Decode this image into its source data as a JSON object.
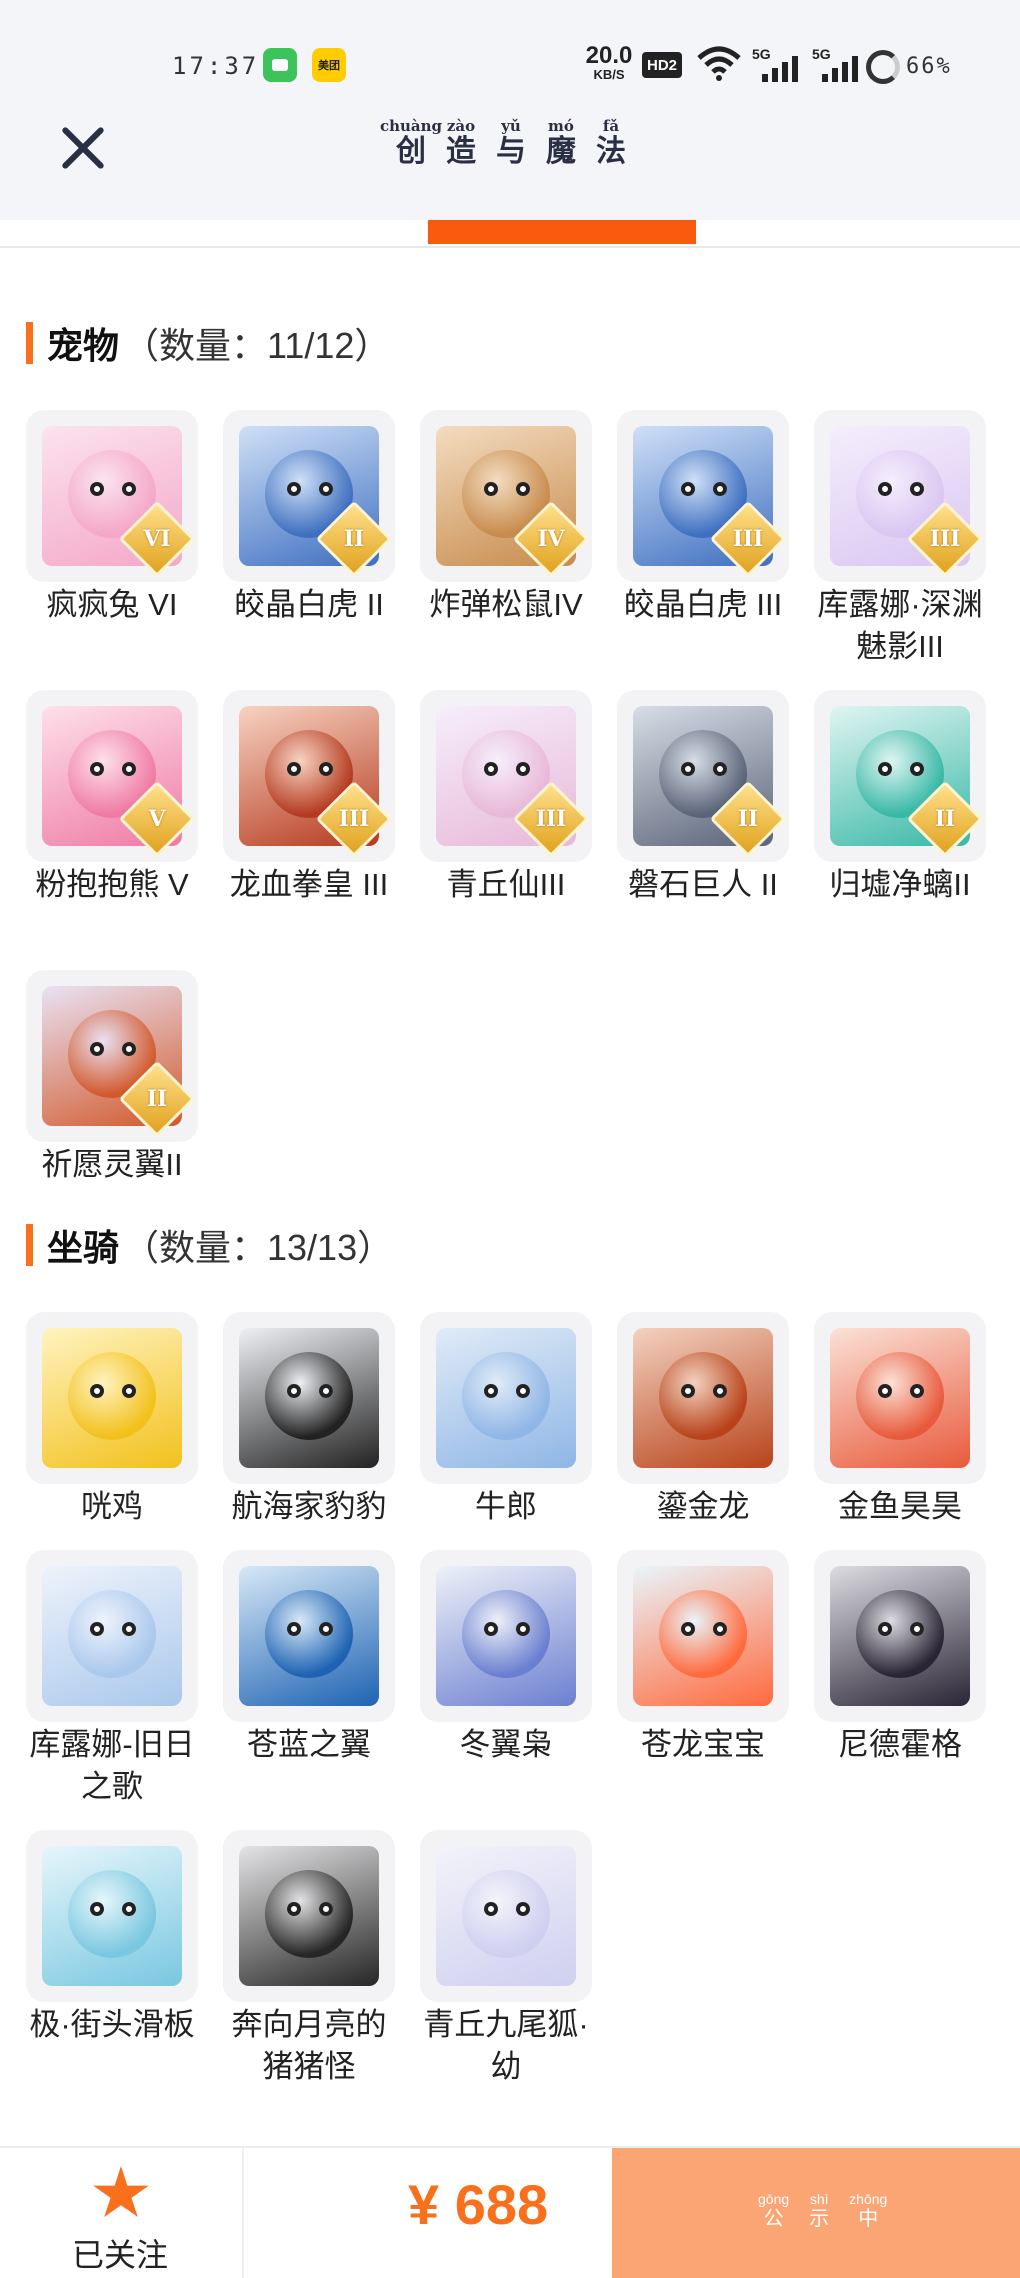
{
  "status_bar": {
    "time": "17:37",
    "app_icons": [
      "message-icon",
      "meituan-icon"
    ],
    "meituan_label": "美团",
    "speed_value": "20.0",
    "speed_unit": "KB/S",
    "hd_label": "HD2",
    "signal1": "5G",
    "signal2": "5G",
    "battery": "66%"
  },
  "header": {
    "title_chars": [
      {
        "py": "chuàng",
        "hz": "创"
      },
      {
        "py": "zào",
        "hz": "造"
      },
      {
        "py": "yǔ",
        "hz": "与"
      },
      {
        "py": "mó",
        "hz": "魔"
      },
      {
        "py": "fǎ",
        "hz": "法"
      }
    ],
    "accent_color": "#f85b0e"
  },
  "pets": {
    "title": "宠物",
    "count": "（数量：11/12）",
    "items": [
      {
        "label": "疯疯兔 VI",
        "badge": "VI"
      },
      {
        "label": "皎晶白虎 II",
        "badge": "II"
      },
      {
        "label": "炸弹松鼠IV",
        "badge": "IV"
      },
      {
        "label": "皎晶白虎 III",
        "badge": "III"
      },
      {
        "label": "库露娜·深渊魅影III",
        "badge": "III"
      },
      {
        "label": "粉抱抱熊 V",
        "badge": "V"
      },
      {
        "label": "龙血拳皇 III",
        "badge": "III"
      },
      {
        "label": "青丘仙III",
        "badge": "III"
      },
      {
        "label": "磐石巨人 II",
        "badge": "II"
      },
      {
        "label": "归墟净螭II",
        "badge": "II"
      },
      {
        "label": "祈愿灵翼II",
        "badge": "II"
      }
    ]
  },
  "mounts": {
    "title": "坐骑",
    "count": "（数量：13/13）",
    "items": [
      {
        "label": "咣鸡"
      },
      {
        "label": "航海家豹豹"
      },
      {
        "label": "牛郎"
      },
      {
        "label": "鎏金龙"
      },
      {
        "label": "金鱼昊昊"
      },
      {
        "label": "库露娜-旧日之歌"
      },
      {
        "label": "苍蓝之翼"
      },
      {
        "label": "冬翼枭"
      },
      {
        "label": "苍龙宝宝"
      },
      {
        "label": "尼德霍格"
      },
      {
        "label": "极·街头滑板"
      },
      {
        "label": "奔向月亮的猪猪怪"
      },
      {
        "label": "青丘九尾狐·幼"
      }
    ]
  },
  "bottom_bar": {
    "follow_label": "已关注",
    "price": "¥ 688",
    "publicity_chars": [
      {
        "py": "gōng",
        "hz": "公"
      },
      {
        "py": "shì",
        "hz": "示"
      },
      {
        "py": "zhōng",
        "hz": "中"
      }
    ]
  }
}
